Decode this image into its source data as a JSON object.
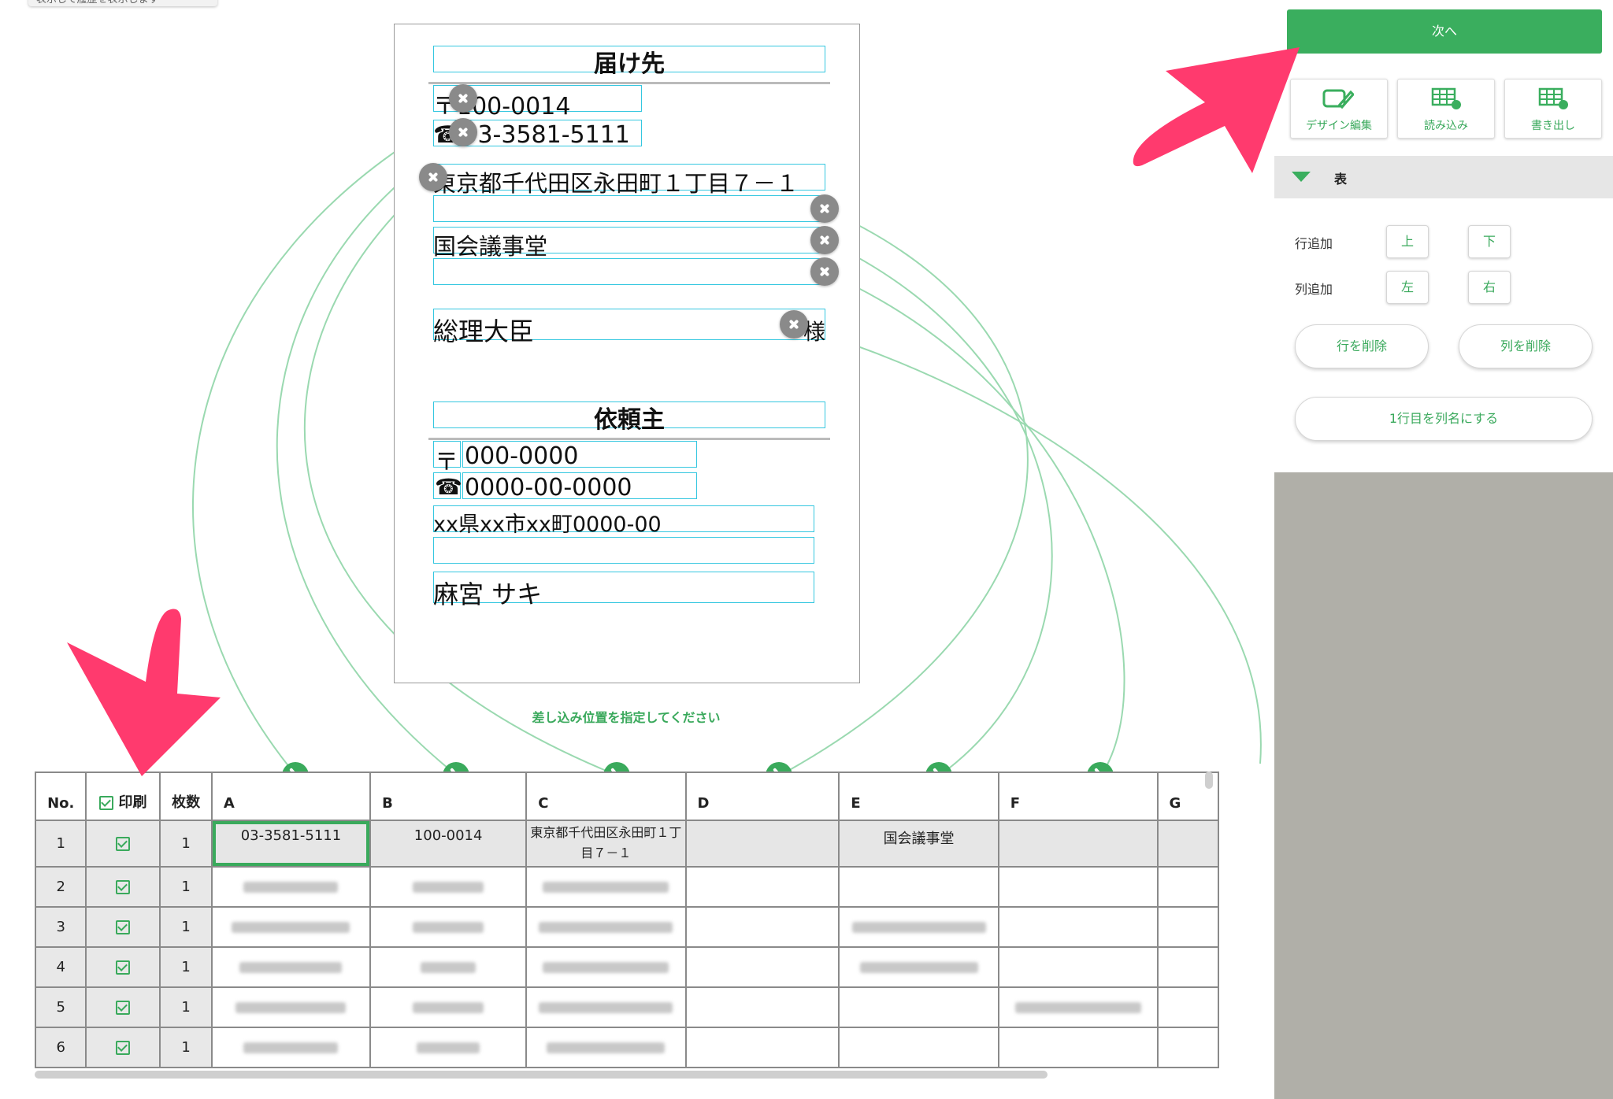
{
  "tooltip": "表示して履歴を表示します",
  "label_sheet": {
    "recipient_header": "届け先",
    "recipient_postal": "〒100-0014",
    "recipient_phone": "☎03-3581-5111",
    "recipient_address": "東京都千代田区永田町１丁目７－１",
    "recipient_building": "",
    "recipient_company": "国会議事堂",
    "recipient_dept": "",
    "recipient_name": "総理大臣",
    "recipient_suffix": "様",
    "sender_header": "依頼主",
    "sender_postal_mark": "〒",
    "sender_postal": "000-0000",
    "sender_phone_mark": "☎",
    "sender_phone": "0000-00-0000",
    "sender_address": "xx県xx市xx町0000-00",
    "sender_building": "",
    "sender_name": "麻宮 サキ"
  },
  "instruction": "差し込み位置を指定してください",
  "grid": {
    "headers": {
      "no": "No.",
      "print": "印刷",
      "count": "枚数",
      "columns": [
        "A",
        "B",
        "C",
        "D",
        "E",
        "F",
        "G"
      ]
    },
    "row1": {
      "no": "1",
      "count": "1",
      "A": "03-3581-5111",
      "B": "100-0014",
      "C": "東京都千代田区永田町１丁目７－１",
      "D": "",
      "E": "国会議事堂",
      "F": ""
    },
    "rows": [
      {
        "no": "2",
        "count": "1"
      },
      {
        "no": "3",
        "count": "1"
      },
      {
        "no": "4",
        "count": "1"
      },
      {
        "no": "5",
        "count": "1"
      },
      {
        "no": "6",
        "count": "1"
      }
    ]
  },
  "panel": {
    "next_label": "次へ",
    "tools": {
      "design_edit": "デザイン編集",
      "import": "読み込み",
      "export": "書き出し"
    },
    "section_title": "表",
    "add_row_label": "行追加",
    "add_row_above": "上",
    "add_row_below": "下",
    "add_col_label": "列追加",
    "add_col_left": "左",
    "add_col_right": "右",
    "delete_row": "行を削除",
    "delete_col": "列を削除",
    "first_row_as_header": "1行目を列名にする"
  },
  "colors": {
    "accent_green": "#3aae5e",
    "annotation_pink": "#ff3a6e",
    "field_border": "#35c7e0"
  }
}
